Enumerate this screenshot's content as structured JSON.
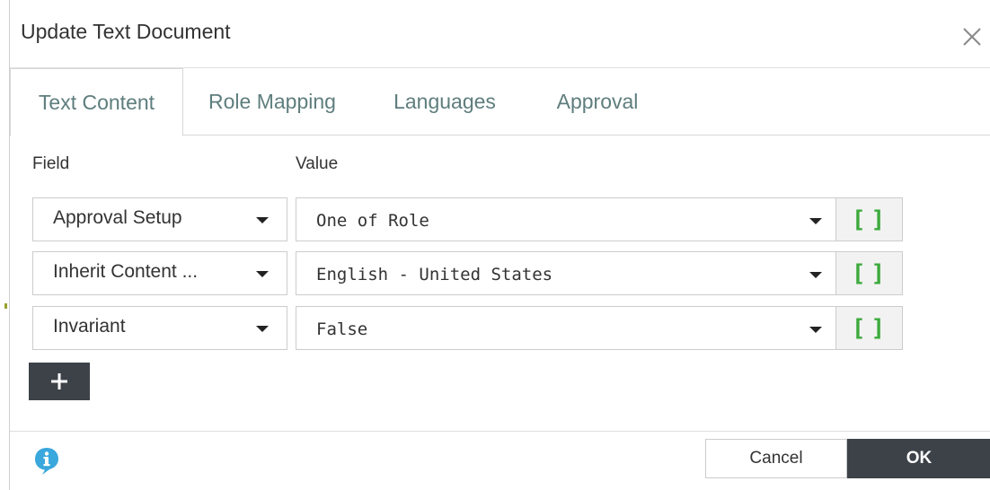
{
  "dialog": {
    "title": "Update Text Document"
  },
  "tabs": [
    {
      "label": "Text Content",
      "active": true
    },
    {
      "label": "Role Mapping",
      "active": false
    },
    {
      "label": "Languages",
      "active": false
    },
    {
      "label": "Approval",
      "active": false
    }
  ],
  "columns": {
    "field": "Field",
    "value": "Value"
  },
  "rows": [
    {
      "field": "Approval Setup",
      "value": "One of Role",
      "bracket": "[]"
    },
    {
      "field": "Inherit Content ...",
      "value": "English - United States",
      "bracket": "[]"
    },
    {
      "field": "Invariant",
      "value": "False",
      "bracket": "[]"
    }
  ],
  "footer": {
    "cancel_label": "Cancel",
    "ok_label": "OK"
  },
  "icons": {
    "close": "close-icon",
    "info": "info-icon",
    "add": "plus-icon",
    "dropdown": "chevron-down-icon"
  },
  "colors": {
    "tab_text": "#5f7d7d",
    "bracket_green": "#3daa3d",
    "dark_button": "#3c4248",
    "info_blue": "#3aa7dd"
  }
}
